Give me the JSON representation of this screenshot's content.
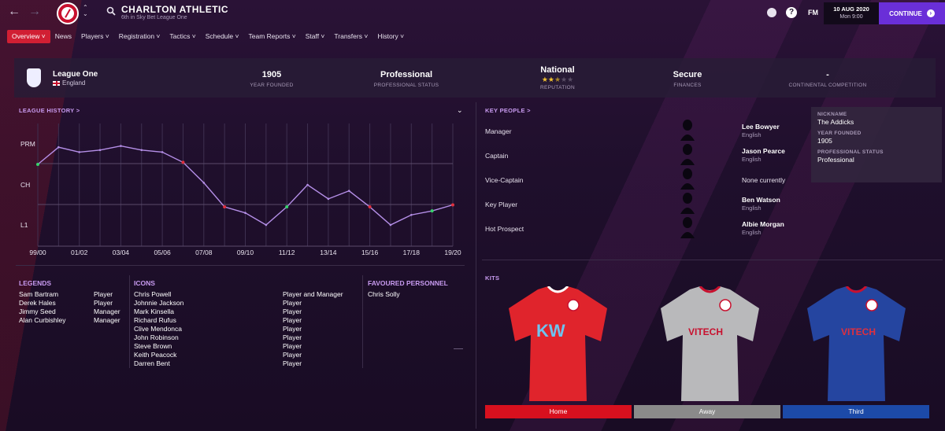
{
  "topbar": {
    "club_name": "CHARLTON ATHLETIC",
    "club_subtitle": "6th in Sky Bet League One",
    "game_label": "FM",
    "date": "10 AUG 2020",
    "day_time": "Mon 9:00",
    "continue_label": "CONTINUE"
  },
  "menu": [
    "Overview",
    "News",
    "Players",
    "Registration",
    "Tactics",
    "Schedule",
    "Team Reports",
    "Staff",
    "Transfers",
    "History"
  ],
  "strip": {
    "league_name": "League One",
    "league_country": "England",
    "year_founded": "1905",
    "year_founded_label": "YEAR FOUNDED",
    "professional_status": "Professional",
    "professional_status_label": "PROFESSIONAL STATUS",
    "reputation": "National",
    "reputation_label": "REPUTATION",
    "reputation_stars": 2.5,
    "finances": "Secure",
    "finances_label": "FINANCES",
    "continental": "-",
    "continental_label": "CONTINENTAL COMPETITION"
  },
  "league_history": {
    "title": "LEAGUE HISTORY >",
    "y_levels": [
      "PRM",
      "CH",
      "L1"
    ],
    "x_labels": [
      "99/00",
      "01/02",
      "03/04",
      "05/06",
      "07/08",
      "09/10",
      "11/12",
      "13/14",
      "15/16",
      "17/18",
      "19/20"
    ]
  },
  "chart_data": {
    "type": "line",
    "title": "LEAGUE HISTORY",
    "x": [
      "99/00",
      "00/01",
      "01/02",
      "02/03",
      "03/04",
      "04/05",
      "05/06",
      "06/07",
      "07/08",
      "08/09",
      "09/10",
      "10/11",
      "11/12",
      "12/13",
      "13/14",
      "14/15",
      "15/16",
      "16/17",
      "17/18",
      "18/19",
      "19/20"
    ],
    "y_categories": [
      "PRM",
      "CH",
      "L1"
    ],
    "values": [
      0.5,
      0.08,
      0.2,
      0.15,
      0.05,
      0.15,
      0.2,
      0.45,
      0.95,
      1.55,
      1.7,
      2.0,
      1.55,
      1.0,
      1.35,
      1.15,
      1.55,
      2.0,
      1.75,
      1.65,
      1.5
    ],
    "markers": {
      "7": "#e0303e",
      "8": "none",
      "0": "#36d36a",
      "12": "#36d36a",
      "19": "#36d36a",
      "9": "#e0303e",
      "16": "#e0303e",
      "20": "#e0303e"
    },
    "line_color": "#b58fe8",
    "grid": true
  },
  "key_people": {
    "title": "KEY PEOPLE >",
    "rows": [
      {
        "role": "Manager",
        "name": "Lee Bowyer",
        "nationality": "English"
      },
      {
        "role": "Captain",
        "name": "Jason Pearce",
        "nationality": "English"
      },
      {
        "role": "Vice-Captain",
        "name": "",
        "nationality": "",
        "none_text": "None currently"
      },
      {
        "role": "Key Player",
        "name": "Ben Watson",
        "nationality": "English"
      },
      {
        "role": "Hot Prospect",
        "name": "Albie Morgan",
        "nationality": "English"
      }
    ]
  },
  "club_info": {
    "nickname_label": "NICKNAME",
    "nickname": "The Addicks",
    "year_founded_label": "YEAR FOUNDED",
    "year_founded": "1905",
    "status_label": "PROFESSIONAL STATUS",
    "status": "Professional"
  },
  "legends": {
    "title": "LEGENDS",
    "rows": [
      {
        "name": "Sam Bartram",
        "role": "Player"
      },
      {
        "name": "Derek Hales",
        "role": "Player"
      },
      {
        "name": "Jimmy Seed",
        "role": "Manager"
      },
      {
        "name": "Alan Curbishley",
        "role": "Manager"
      }
    ]
  },
  "icons": {
    "title": "ICONS",
    "rows": [
      {
        "name": "Chris Powell",
        "role": "Player and Manager"
      },
      {
        "name": "Johnnie Jackson",
        "role": "Player"
      },
      {
        "name": "Mark Kinsella",
        "role": "Player"
      },
      {
        "name": "Richard Rufus",
        "role": "Player"
      },
      {
        "name": "Clive Mendonca",
        "role": "Player"
      },
      {
        "name": "John Robinson",
        "role": "Player"
      },
      {
        "name": "Steve Brown",
        "role": "Player"
      },
      {
        "name": "Keith Peacock",
        "role": "Player"
      },
      {
        "name": "Darren Bent",
        "role": "Player"
      }
    ]
  },
  "favoured": {
    "title": "FAVOURED PERSONNEL",
    "rows": [
      "Chris Solly"
    ]
  },
  "kits": {
    "title": "KITS",
    "items": [
      {
        "label": "Home",
        "color": "#d8101e",
        "shirt": "#e0242c",
        "sponsor": "KW"
      },
      {
        "label": "Away",
        "color": "#8a8a8a",
        "shirt": "#b9b9bb",
        "sponsor": "VITECH"
      },
      {
        "label": "Third",
        "color": "#1c4aa8",
        "shirt": "#2545a0",
        "sponsor": "VITECH"
      }
    ]
  },
  "colors": {
    "accent": "#6a2fd8",
    "active_tab": "#d11f33",
    "section_title": "#c89bf0"
  }
}
